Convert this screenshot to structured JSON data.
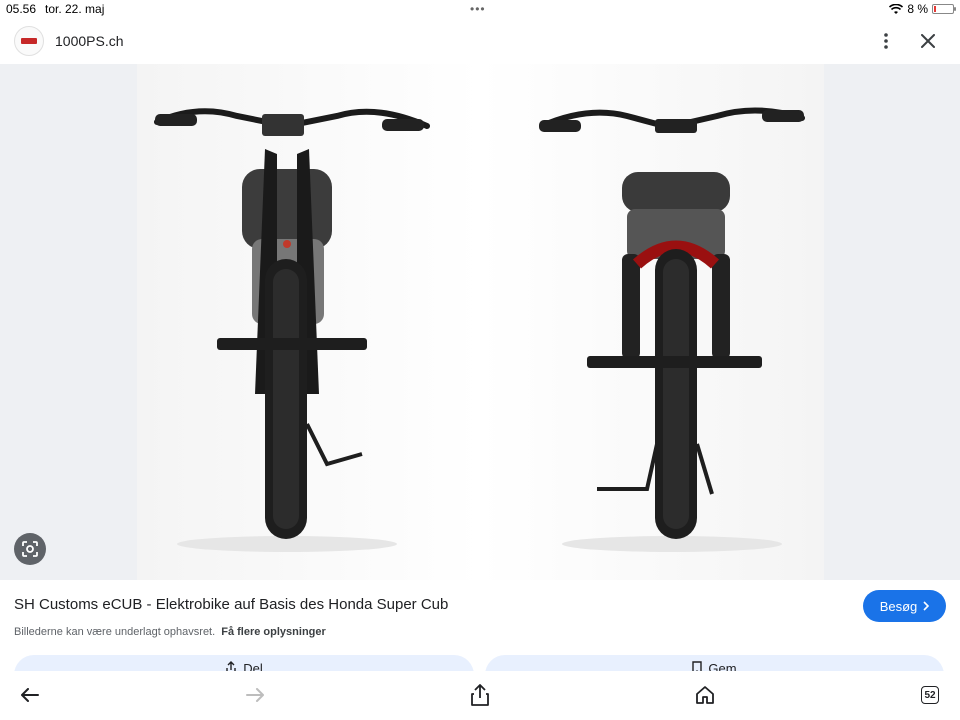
{
  "status_bar": {
    "time": "05.56",
    "date": "tor. 22. maj",
    "battery_percent": "8 %",
    "battery_color": "#e53935"
  },
  "header": {
    "site_name": "1000PS.ch",
    "menu_icon": "more-vertical-icon",
    "close_icon": "close-icon"
  },
  "image": {
    "lens_icon": "google-lens-icon"
  },
  "caption": {
    "title": "SH Customs eCUB - Elektrobike auf Basis des Honda Super Cub",
    "visit_label": "Besøg",
    "copyright_text": "Billederne kan være underlagt ophavsret.",
    "more_info": "Få flere oplysninger",
    "accent_color": "#1a73e8"
  },
  "actions": {
    "share_label": "Del",
    "save_label": "Gem"
  },
  "toolbar": {
    "tabs_count": "52",
    "icons": [
      "back-icon",
      "forward-icon",
      "share-icon",
      "home-icon",
      "tabs-icon"
    ]
  }
}
